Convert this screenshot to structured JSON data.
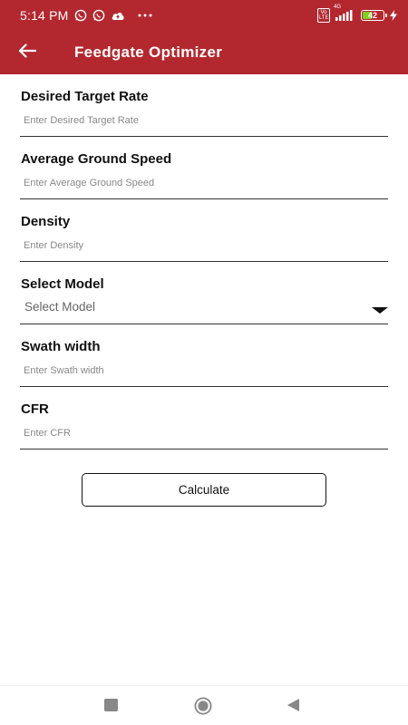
{
  "status_bar": {
    "time": "5:14 PM",
    "notification_icons": [
      "whatsapp-icon",
      "whatsapp-icon",
      "cloud-upload-icon",
      "more-dots-icon"
    ],
    "volte_label": "Vo LTE",
    "network_label": "4G",
    "battery_level": "42",
    "battery_fraction": 0.42,
    "charging": true
  },
  "app_bar": {
    "title": "Feedgate Optimizer",
    "back_icon": "arrow-left-icon",
    "background_color": "#b3282f"
  },
  "form": {
    "fields": [
      {
        "label": "Desired Target Rate",
        "placeholder": "Enter Desired Target Rate",
        "value": ""
      },
      {
        "label": "Average Ground Speed",
        "placeholder": "Enter Average Ground Speed",
        "value": ""
      },
      {
        "label": "Density",
        "placeholder": "Enter Density",
        "value": ""
      },
      {
        "label": "Select Model",
        "selected": "Select Model",
        "type": "select"
      },
      {
        "label": "Swath width",
        "placeholder": "Enter Swath width",
        "value": ""
      },
      {
        "label": "CFR",
        "placeholder": "Enter CFR",
        "value": ""
      }
    ],
    "calculate_label": "Calculate"
  },
  "nav_bar": {
    "buttons": [
      "recents-square-icon",
      "home-circle-icon",
      "back-triangle-icon"
    ]
  }
}
